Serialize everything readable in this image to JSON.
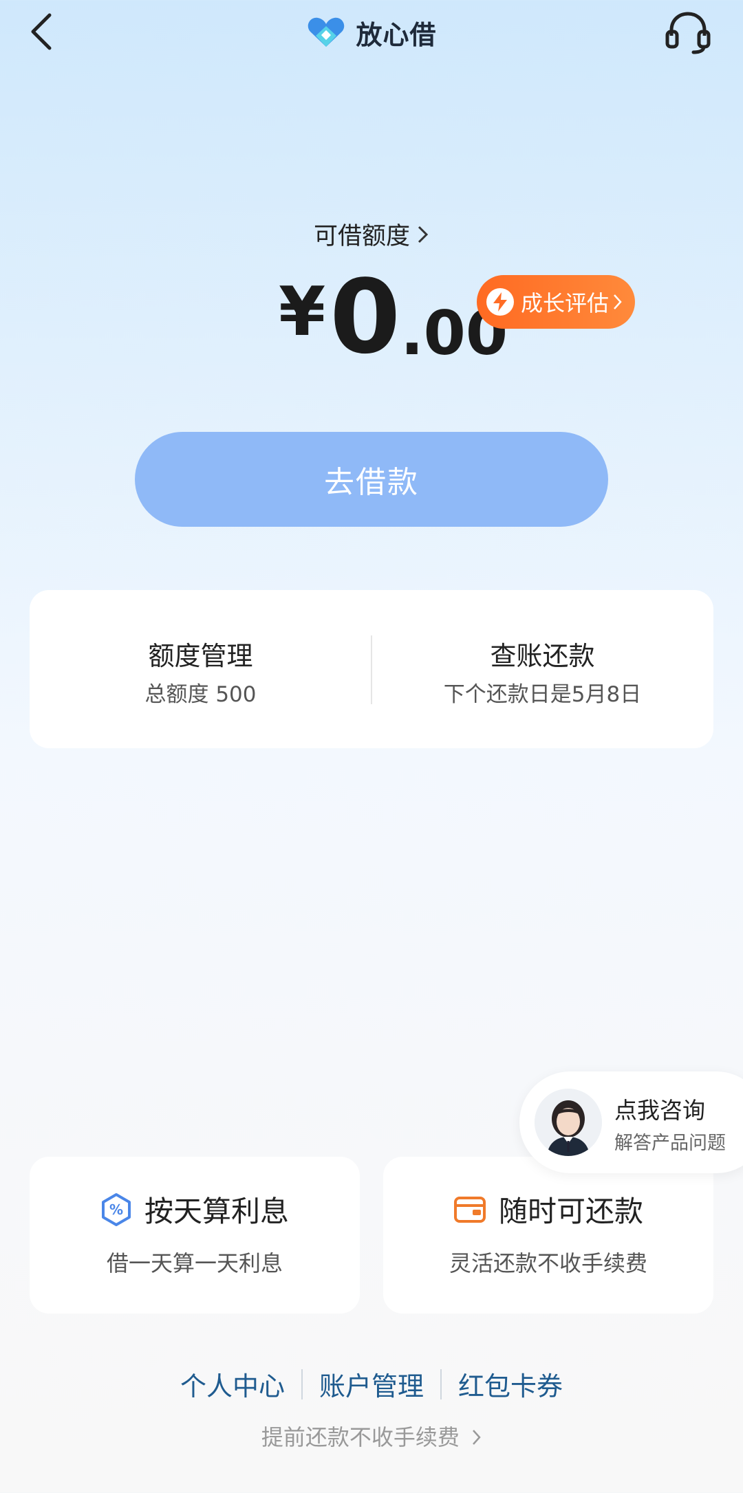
{
  "header": {
    "brand": "放心借",
    "back_icon": "back-chevron-icon",
    "service_icon": "headset-icon"
  },
  "quota": {
    "label": "可借额度",
    "currency": "¥",
    "amount_int": "0",
    "amount_dec": ".00",
    "growth_label": "成长评估"
  },
  "borrow_button": "去借款",
  "info_card": {
    "left_title": "额度管理",
    "left_sub": "总额度 500",
    "right_title": "查账还款",
    "right_sub": "下个还款日是5月8日"
  },
  "consult": {
    "title": "点我咨询",
    "sub": "解答产品问题"
  },
  "features": [
    {
      "title": "按天算利息",
      "sub": "借一天算一天利息",
      "icon": "percent-hexagon-icon",
      "color": "#4a86e8"
    },
    {
      "title": "随时可还款",
      "sub": "灵活还款不收手续费",
      "icon": "wallet-icon",
      "color": "#f07a2a"
    }
  ],
  "bottom_links": [
    "个人中心",
    "账户管理",
    "红包卡券"
  ],
  "prepay_text": "提前还款不收手续费",
  "colors": {
    "accent_orange": "#ff7a2e",
    "button_blue": "#8fb9f7",
    "link_blue": "#1f5b8f"
  }
}
